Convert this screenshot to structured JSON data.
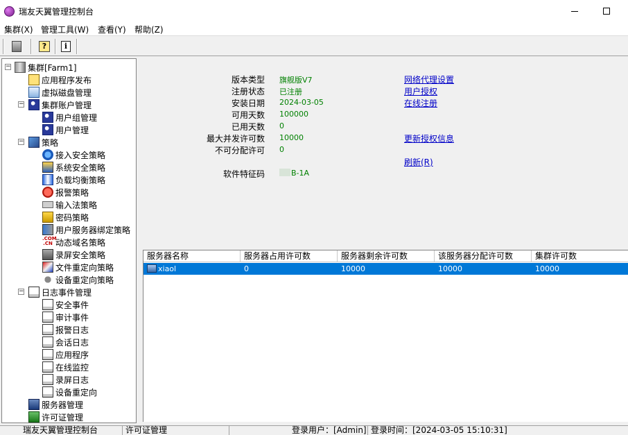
{
  "window": {
    "title": "瑞友天翼管理控制台"
  },
  "menu": [
    {
      "label": "集群(X)"
    },
    {
      "label": "管理工具(W)"
    },
    {
      "label": "查看(Y)"
    },
    {
      "label": "帮助(Z)"
    }
  ],
  "toolbar": [
    {
      "icon": "server-icon"
    },
    {
      "icon": "help-icon"
    },
    {
      "icon": "info-icon"
    }
  ],
  "tree": {
    "root": "集群[Farm1]",
    "items": [
      {
        "label": "应用程序发布",
        "icon": "app-publish-icon"
      },
      {
        "label": "虚拟磁盘管理",
        "icon": "virtual-disk-icon"
      },
      {
        "label": "集群账户管理",
        "icon": "users-icon"
      },
      {
        "label": "用户组管理",
        "icon": "user-group-icon"
      },
      {
        "label": "用户管理",
        "icon": "user-icon"
      },
      {
        "label": "策略",
        "icon": "policy-icon"
      },
      {
        "label": "接入安全策略",
        "icon": "access-security-icon"
      },
      {
        "label": "系统安全策略",
        "icon": "system-security-icon"
      },
      {
        "label": "负载均衡策略",
        "icon": "load-balance-icon"
      },
      {
        "label": "报警策略",
        "icon": "alarm-icon"
      },
      {
        "label": "输入法策略",
        "icon": "keyboard-icon"
      },
      {
        "label": "密码策略",
        "icon": "lock-icon"
      },
      {
        "label": "用户服务器绑定策略",
        "icon": "bind-icon"
      },
      {
        "label": "动态域名策略",
        "icon": "com-cn-icon"
      },
      {
        "label": "录屏安全策略",
        "icon": "screen-record-icon"
      },
      {
        "label": "文件重定向策略",
        "icon": "file-redirect-icon"
      },
      {
        "label": "设备重定向策略",
        "icon": "device-icon"
      },
      {
        "label": "日志事件管理",
        "icon": "log-icon"
      },
      {
        "label": "安全事件",
        "icon": "log-icon"
      },
      {
        "label": "审计事件",
        "icon": "log-icon"
      },
      {
        "label": "报警日志",
        "icon": "log-icon"
      },
      {
        "label": "会话日志",
        "icon": "log-icon"
      },
      {
        "label": "应用程序",
        "icon": "log-icon"
      },
      {
        "label": "在线监控",
        "icon": "log-icon"
      },
      {
        "label": "录屏日志",
        "icon": "log-icon"
      },
      {
        "label": "设备重定向",
        "icon": "log-icon"
      },
      {
        "label": "服务器管理",
        "icon": "server-mgmt-icon"
      },
      {
        "label": "许可证管理",
        "icon": "license-icon"
      }
    ]
  },
  "license_info": {
    "rows": [
      {
        "label": "版本类型",
        "value": "旗舰版V7"
      },
      {
        "label": "注册状态",
        "value": "已注册"
      },
      {
        "label": "安装日期",
        "value": "2024-03-05"
      },
      {
        "label": "可用天数",
        "value": "100000"
      },
      {
        "label": "已用天数",
        "value": "0"
      },
      {
        "label": "最大并发许可数",
        "value": "10000"
      },
      {
        "label": "不可分配许可",
        "value": "0"
      },
      {
        "label": "软件特征码",
        "value": "B-1A"
      }
    ],
    "links": [
      {
        "label": "网络代理设置"
      },
      {
        "label": "用户授权"
      },
      {
        "label": "在线注册"
      },
      {
        "label": "更新授权信息"
      },
      {
        "label": "刷新(R)"
      }
    ]
  },
  "server_table": {
    "columns": [
      "服务器名称",
      "服务器占用许可数",
      "服务器剩余许可数",
      "该服务器分配许可数",
      "集群许可数"
    ],
    "rows": [
      [
        "xiaol",
        "0",
        "10000",
        "10000",
        "10000"
      ]
    ]
  },
  "status": {
    "app": "瑞友天翼管理控制台",
    "current": "许可证管理",
    "user": "登录用户：[Admin]",
    "time": "登录时间：[2024-03-05 15:10:31]"
  },
  "colors": {
    "selection": "#0078d7",
    "value_green": "#008000",
    "link_blue": "#0000c8"
  }
}
